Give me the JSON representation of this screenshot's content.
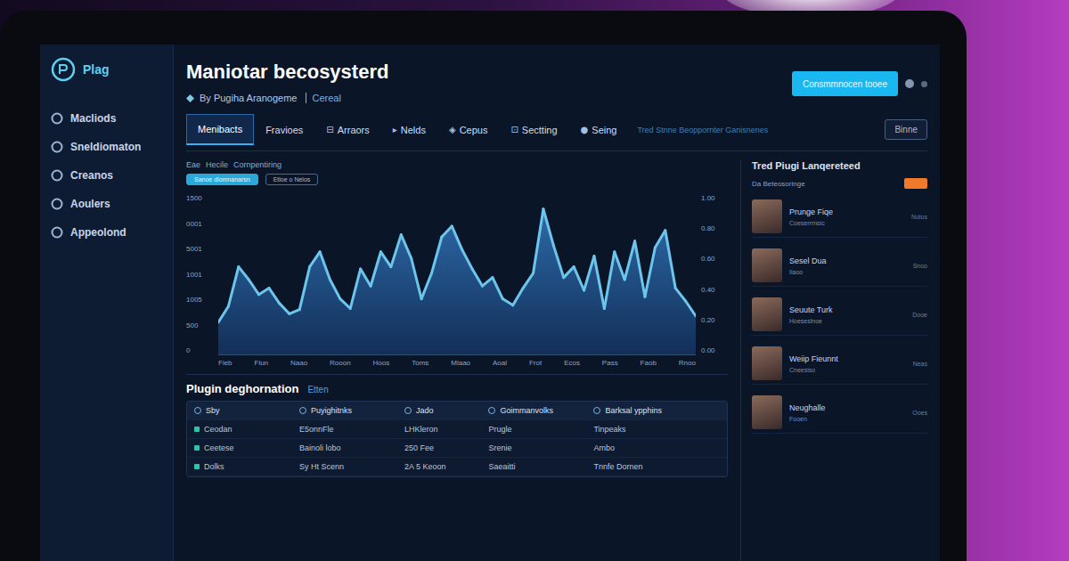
{
  "logo": {
    "text": "Plag"
  },
  "sidebar": {
    "items": [
      {
        "label": "Macliods"
      },
      {
        "label": "Sneldiomaton"
      },
      {
        "label": "Creanos"
      },
      {
        "label": "Aoulers"
      },
      {
        "label": "Appeolond"
      }
    ]
  },
  "header": {
    "title": "Maniotar becosysterd",
    "subtitle": "By Pugiha Aranogeme",
    "link": "Cereal",
    "button": "Consmmnocen tooee"
  },
  "tabs": [
    {
      "label": "Menibacts",
      "icon": "",
      "selected": true
    },
    {
      "label": "Fravioes",
      "icon": "",
      "selected": false
    },
    {
      "label": "Arraors",
      "icon": "⊟",
      "selected": false
    },
    {
      "label": "Nelds",
      "icon": "▸",
      "selected": false
    },
    {
      "label": "Cepus",
      "icon": "◈",
      "selected": false
    },
    {
      "label": "Sectting",
      "icon": "⊡",
      "selected": false
    },
    {
      "label": "Seing",
      "icon": "●",
      "selected": false
    }
  ],
  "tabs_note": "Tred Stnne Beoppornter Ganisnenes",
  "tabs_button": "Binne",
  "chart": {
    "legend": [
      "Eae",
      "Hecile",
      "Cornpentiring"
    ],
    "pills": [
      "Sanoe dlomnanarsn",
      "Etloe o Nelos"
    ],
    "y_ticks": [
      "1500",
      "0001",
      "5001",
      "1001",
      "1005",
      "500",
      "0"
    ],
    "y2_ticks": [
      "1.00",
      "0.80",
      "0.60",
      "0.40",
      "0.20",
      "0.00"
    ],
    "x_labels": [
      "Fieb",
      "Fiun",
      "Naao",
      "Rooon",
      "Hoos",
      "Toms",
      "Mlaao",
      "Aoal",
      "Frot",
      "Ecos",
      "Pass",
      "Faob",
      "Rnoo"
    ],
    "y_max": 1500,
    "series": [
      {
        "values": [
          300,
          450,
          820,
          700,
          560,
          620,
          480,
          380,
          420,
          820,
          960,
          700,
          520,
          430,
          800,
          640,
          960,
          820,
          1120,
          900,
          520,
          760,
          1100,
          1200,
          980,
          800,
          640,
          720,
          520,
          460,
          620,
          760,
          1360,
          1020,
          720,
          820,
          600,
          920,
          430,
          960,
          700,
          1060,
          540,
          1000,
          1160,
          620,
          500,
          360
        ]
      }
    ]
  },
  "panel": {
    "title": "Tred Piugi Lanqereteed",
    "subtitle": "Da Beteosoringe",
    "people": [
      {
        "name": "Prunge Fiqe",
        "detail": "Coeserrrnsic",
        "meta": "Nolos"
      },
      {
        "name": "Sesel Dua",
        "detail": "Ilaoo",
        "meta": "Snoo"
      },
      {
        "name": "Seuute Turk",
        "detail": "Hoeseslnoe",
        "meta": "Dooe"
      },
      {
        "name": "Weiip Fieunnt",
        "detail": "Cneesiso",
        "meta": "Neas"
      },
      {
        "name": "Neughalle",
        "detail": "Fooen",
        "meta": "Ooes"
      }
    ]
  },
  "table": {
    "title": "Plugin deghornation",
    "link": "Etten",
    "columns": [
      "Sby",
      "Puyighitnks",
      "Jado",
      "Goimmanvolks",
      "Barksal ypphins"
    ],
    "rows": [
      {
        "cells": [
          "Ceodan",
          "E5onnFle",
          "LHKleron",
          "Prugle",
          "Tinpeaks"
        ]
      },
      {
        "cells": [
          "Ceetese",
          "Bainoli lobo",
          "250 Fee",
          "Srenie",
          "Ambo"
        ]
      },
      {
        "cells": [
          "Dolks",
          "Sy Ht Scenn",
          "2A 5 Keoon",
          "Saeaitti",
          "Tnnfe Dornen"
        ]
      }
    ]
  }
}
